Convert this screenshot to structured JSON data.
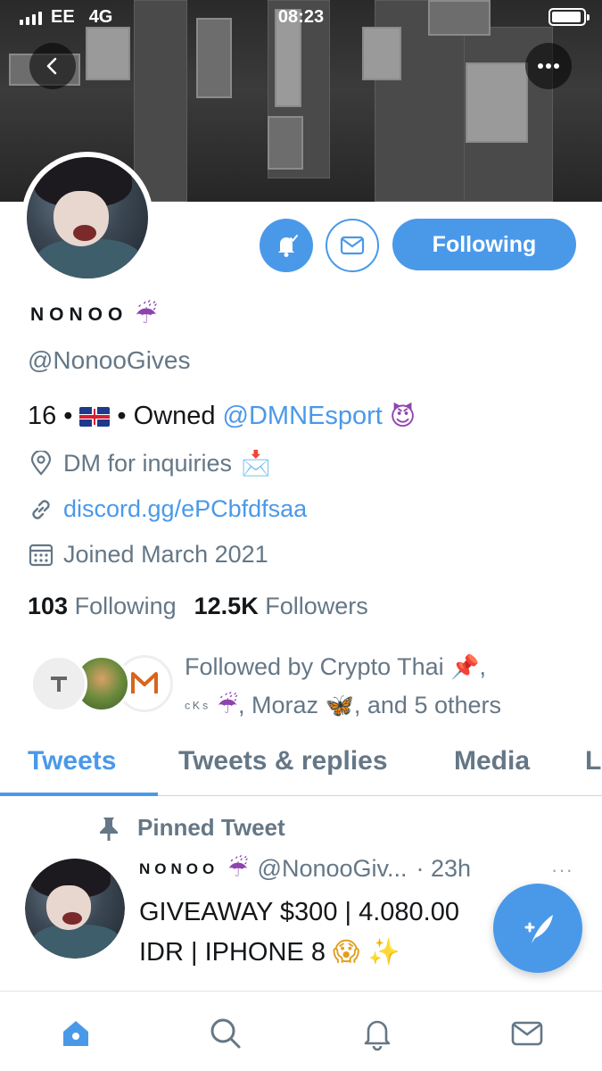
{
  "status_bar": {
    "carrier": "EE",
    "network": "4G",
    "time": "08:23"
  },
  "header": {
    "back_icon": "chevron-left-icon",
    "more_icon": "ellipsis-icon"
  },
  "profile": {
    "name": "Nonoo",
    "name_emoji": "☔",
    "handle": "@NonooGives",
    "bio": {
      "age": "16",
      "separator": "•",
      "owned_text": "• Owned",
      "mention": "@DMNEsport",
      "emoji": "😈"
    },
    "location": "DM for inquiries",
    "location_emoji": "📩",
    "website": "discord.gg/ePCbfdfsaa",
    "joined": "Joined March 2021",
    "following_count": "103",
    "following_label": "Following",
    "followers_count": "12.5K",
    "followers_label": "Followers"
  },
  "actions": {
    "notify_icon": "bell-icon",
    "message_icon": "mail-icon",
    "following_label": "Following"
  },
  "followed_by": {
    "text_start": "Followed by Crypto Thai",
    "pin_emoji": "📌",
    "text_mid_name": "ᶜᴷˢ",
    "umbrella_emoji": "☔",
    "text_mid": ", Moraz",
    "butterfly_emoji": "🦋",
    "text_end": ", and 5 others"
  },
  "tabs": [
    {
      "label": "Tweets",
      "active": true
    },
    {
      "label": "Tweets & replies",
      "active": false
    },
    {
      "label": "Media",
      "active": false
    },
    {
      "label": "L",
      "active": false
    }
  ],
  "pinned_tweet": {
    "pinned_label": "Pinned Tweet",
    "author_name": "Nonoo",
    "author_emoji": "☔",
    "author_handle": "@NonooGiv...",
    "time": "· 23h",
    "more": "···",
    "body_line1": "GIVEAWAY $300 | 4.080.00",
    "body_line2": "IDR | IPHONE 8",
    "body_emoji": "😱 ✨"
  },
  "bottom_nav": [
    {
      "icon": "home-icon",
      "active": true
    },
    {
      "icon": "search-icon",
      "active": false
    },
    {
      "icon": "bell-icon",
      "active": false
    },
    {
      "icon": "mail-icon",
      "active": false
    }
  ],
  "colors": {
    "accent": "#4a99e9",
    "text_primary": "#14171a",
    "text_secondary": "#657786",
    "divider": "#ccd6dd"
  }
}
